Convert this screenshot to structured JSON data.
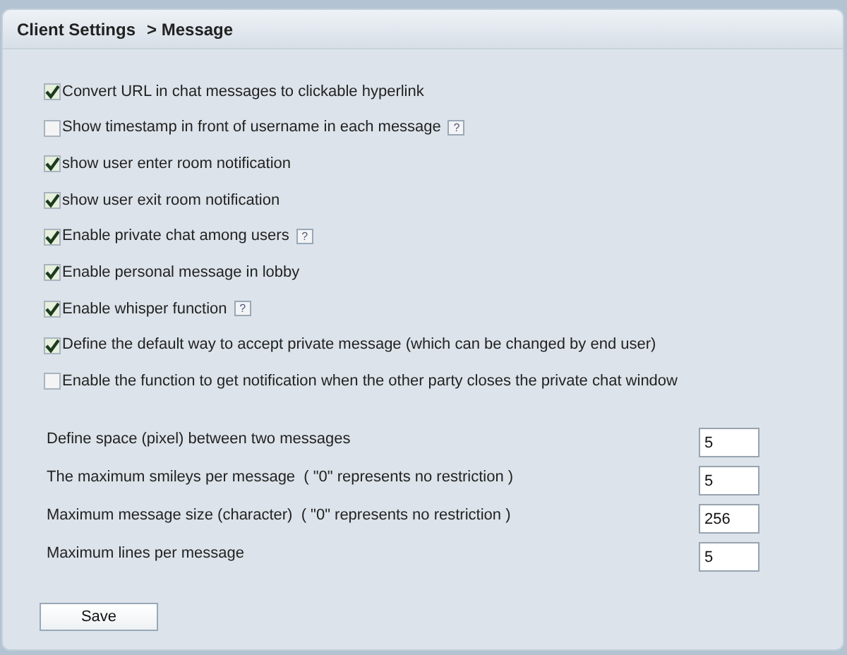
{
  "header": {
    "section": "Client Settings",
    "page": "> Message"
  },
  "options": [
    {
      "label": "Convert URL in chat messages to clickable hyperlink",
      "checked": true
    },
    {
      "label": "Show timestamp in front of username in each message",
      "checked": false,
      "help": "?"
    },
    {
      "label": "show user enter room notification",
      "checked": true
    },
    {
      "label": "show user exit room notification",
      "checked": true
    },
    {
      "label": "Enable private chat among users",
      "checked": true,
      "help": "?"
    },
    {
      "label": "Enable personal message in lobby",
      "checked": true
    },
    {
      "label": "Enable whisper function",
      "checked": true,
      "help": "?"
    },
    {
      "label": "Define the default way to accept private message (which can be changed by end user)",
      "checked": true
    },
    {
      "label": "Enable the function to get notification when the other party closes the private chat window",
      "checked": false
    }
  ],
  "fields": [
    {
      "label": "Define space (pixel) between two messages",
      "value": "5"
    },
    {
      "label": "The maximum smileys per message  ( \"0\" represents no restriction )",
      "value": "5"
    },
    {
      "label": "Maximum message size (character)  ( \"0\" represents no restriction )",
      "value": "256"
    },
    {
      "label": "Maximum lines per message",
      "value": "5"
    }
  ],
  "save_button": "Save"
}
